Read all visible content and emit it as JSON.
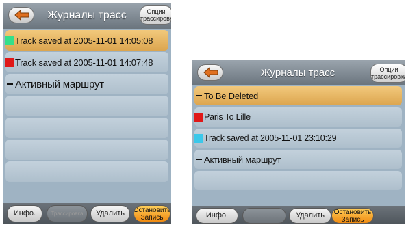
{
  "left_screen": {
    "title": "Журналы трасс",
    "options_button": {
      "line1": "Опции",
      "line2": "трассировки"
    },
    "items": [
      {
        "label": "Track saved at 2005-11-01 14:05:08",
        "marker": "swatch",
        "color": "#33e08a",
        "selected": true
      },
      {
        "label": "Track saved at 2005-11-01 14:07:48",
        "marker": "swatch",
        "color": "#e01818",
        "selected": false
      },
      {
        "label": "Активный маршрут",
        "marker": "dash",
        "color": "",
        "selected": false
      },
      {
        "label": "",
        "marker": "none",
        "color": "",
        "selected": false
      },
      {
        "label": "",
        "marker": "none",
        "color": "",
        "selected": false
      },
      {
        "label": "",
        "marker": "none",
        "color": "",
        "selected": false
      },
      {
        "label": "",
        "marker": "none",
        "color": "",
        "selected": false
      }
    ],
    "toolbar": {
      "info": "Инфо.",
      "middle": "Трассировка",
      "delete": "Удалить",
      "stop_line1": "Остановить",
      "stop_line2": "Запись"
    }
  },
  "right_screen": {
    "title": "Журналы трасс",
    "options_button": {
      "line1": "Опции",
      "line2": "трассировки"
    },
    "items": [
      {
        "label": "To Be Deleted",
        "marker": "dash",
        "color": "",
        "selected": true
      },
      {
        "label": "Paris To Lille",
        "marker": "swatch",
        "color": "#e01818",
        "selected": false
      },
      {
        "label": "Track saved at 2005-11-01 23:10:29",
        "marker": "swatch",
        "color": "#3bc8ea",
        "selected": false
      },
      {
        "label": "Активный маршрут",
        "marker": "dash",
        "color": "",
        "selected": false
      },
      {
        "label": "",
        "marker": "none",
        "color": "",
        "selected": false
      }
    ],
    "toolbar": {
      "info": "Инфо.",
      "middle": "",
      "delete": "Удалить",
      "stop_line1": "Остановить",
      "stop_line2": "Запись"
    }
  },
  "colors": {
    "accent_selected": "#dca54f",
    "row_bg": "#b8c8d5",
    "titlebar": "#7c858d",
    "stop_button": "#f08a10"
  },
  "icons": {
    "back": "back-arrow-icon"
  }
}
